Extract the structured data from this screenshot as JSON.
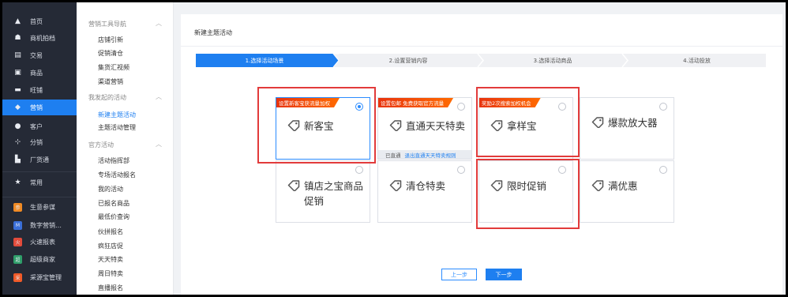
{
  "nav": {
    "items": [
      {
        "label": "首页",
        "icon": "home-icon",
        "glyph": "▲"
      },
      {
        "label": "商机拍档",
        "icon": "handshake-icon",
        "glyph": "☗"
      },
      {
        "label": "交易",
        "icon": "document-icon",
        "glyph": "▤"
      },
      {
        "label": "商品",
        "icon": "image-icon",
        "glyph": "▣"
      },
      {
        "label": "旺铺",
        "icon": "shop-icon",
        "glyph": "▬"
      },
      {
        "label": "营销",
        "icon": "tag-icon",
        "glyph": "◆"
      },
      {
        "label": "客户",
        "icon": "user-icon",
        "glyph": "●"
      },
      {
        "label": "分销",
        "icon": "share-icon",
        "glyph": "⊹"
      },
      {
        "label": "厂货通",
        "icon": "factory-icon",
        "glyph": "▙"
      },
      {
        "label": "常用",
        "icon": "star-icon",
        "glyph": "★"
      },
      {
        "label": "生意参谋",
        "icon": "analytics-app-icon",
        "glyph": "参",
        "color": "#f08a24"
      },
      {
        "label": "数字营销…",
        "icon": "digital-marketing-app-icon",
        "glyph": "M",
        "color": "#3a6fd8"
      },
      {
        "label": "火速报表",
        "icon": "report-app-icon",
        "glyph": "火",
        "color": "#e24b3b"
      },
      {
        "label": "超级商家",
        "icon": "super-merchant-app-icon",
        "glyph": "超",
        "color": "#2f9e6a"
      },
      {
        "label": "采源宝管理",
        "icon": "sourcing-app-icon",
        "glyph": "采",
        "color": "#f05a28"
      }
    ]
  },
  "subnav": {
    "sections": [
      {
        "title": "营销工具导航",
        "items": [
          "店铺引新",
          "促销清仓",
          "集货汇视频",
          "渠道营销"
        ]
      },
      {
        "title": "我发起的活动",
        "items": [
          "新建主题活动",
          "主题活动管理"
        ]
      },
      {
        "title": "官方活动",
        "items": [
          "活动指挥部",
          "专场活动报名",
          "我的活动",
          "已报名商品",
          "最低价查询",
          "伙拼报名",
          "疯狂店促",
          "天天特卖",
          "周日特卖",
          "直播报名"
        ]
      }
    ]
  },
  "main": {
    "title": "新建主题活动",
    "steps": [
      "1.选择活动场景",
      "2.设置营销内容",
      "3.选择活动商品",
      "4.活动投放"
    ],
    "cards": [
      {
        "name": "新客宝",
        "tag": "设置新客宝获流量加权",
        "checked": true
      },
      {
        "name": "直通天天特卖",
        "tag": "设置包邮 免费获取官方流量",
        "checked": false,
        "foot_status": "已直通",
        "foot_link": "退出直通天天特卖规则"
      },
      {
        "name": "拿样宝",
        "tag": "奖励2次搜索加权机会",
        "checked": false
      },
      {
        "name": "爆款放大器",
        "checked": false
      },
      {
        "name": "镇店之宝商品促销",
        "checked": false
      },
      {
        "name": "清仓特卖",
        "checked": false
      },
      {
        "name": "限时促销",
        "checked": false
      },
      {
        "name": "满优惠",
        "checked": false
      }
    ],
    "prev_label": "上一步",
    "next_label": "下一步"
  },
  "colors": {
    "accent": "#1e7ff0",
    "highlight": "#e23b3b",
    "tag": "#ff5a00",
    "nav_bg": "#252a36"
  }
}
